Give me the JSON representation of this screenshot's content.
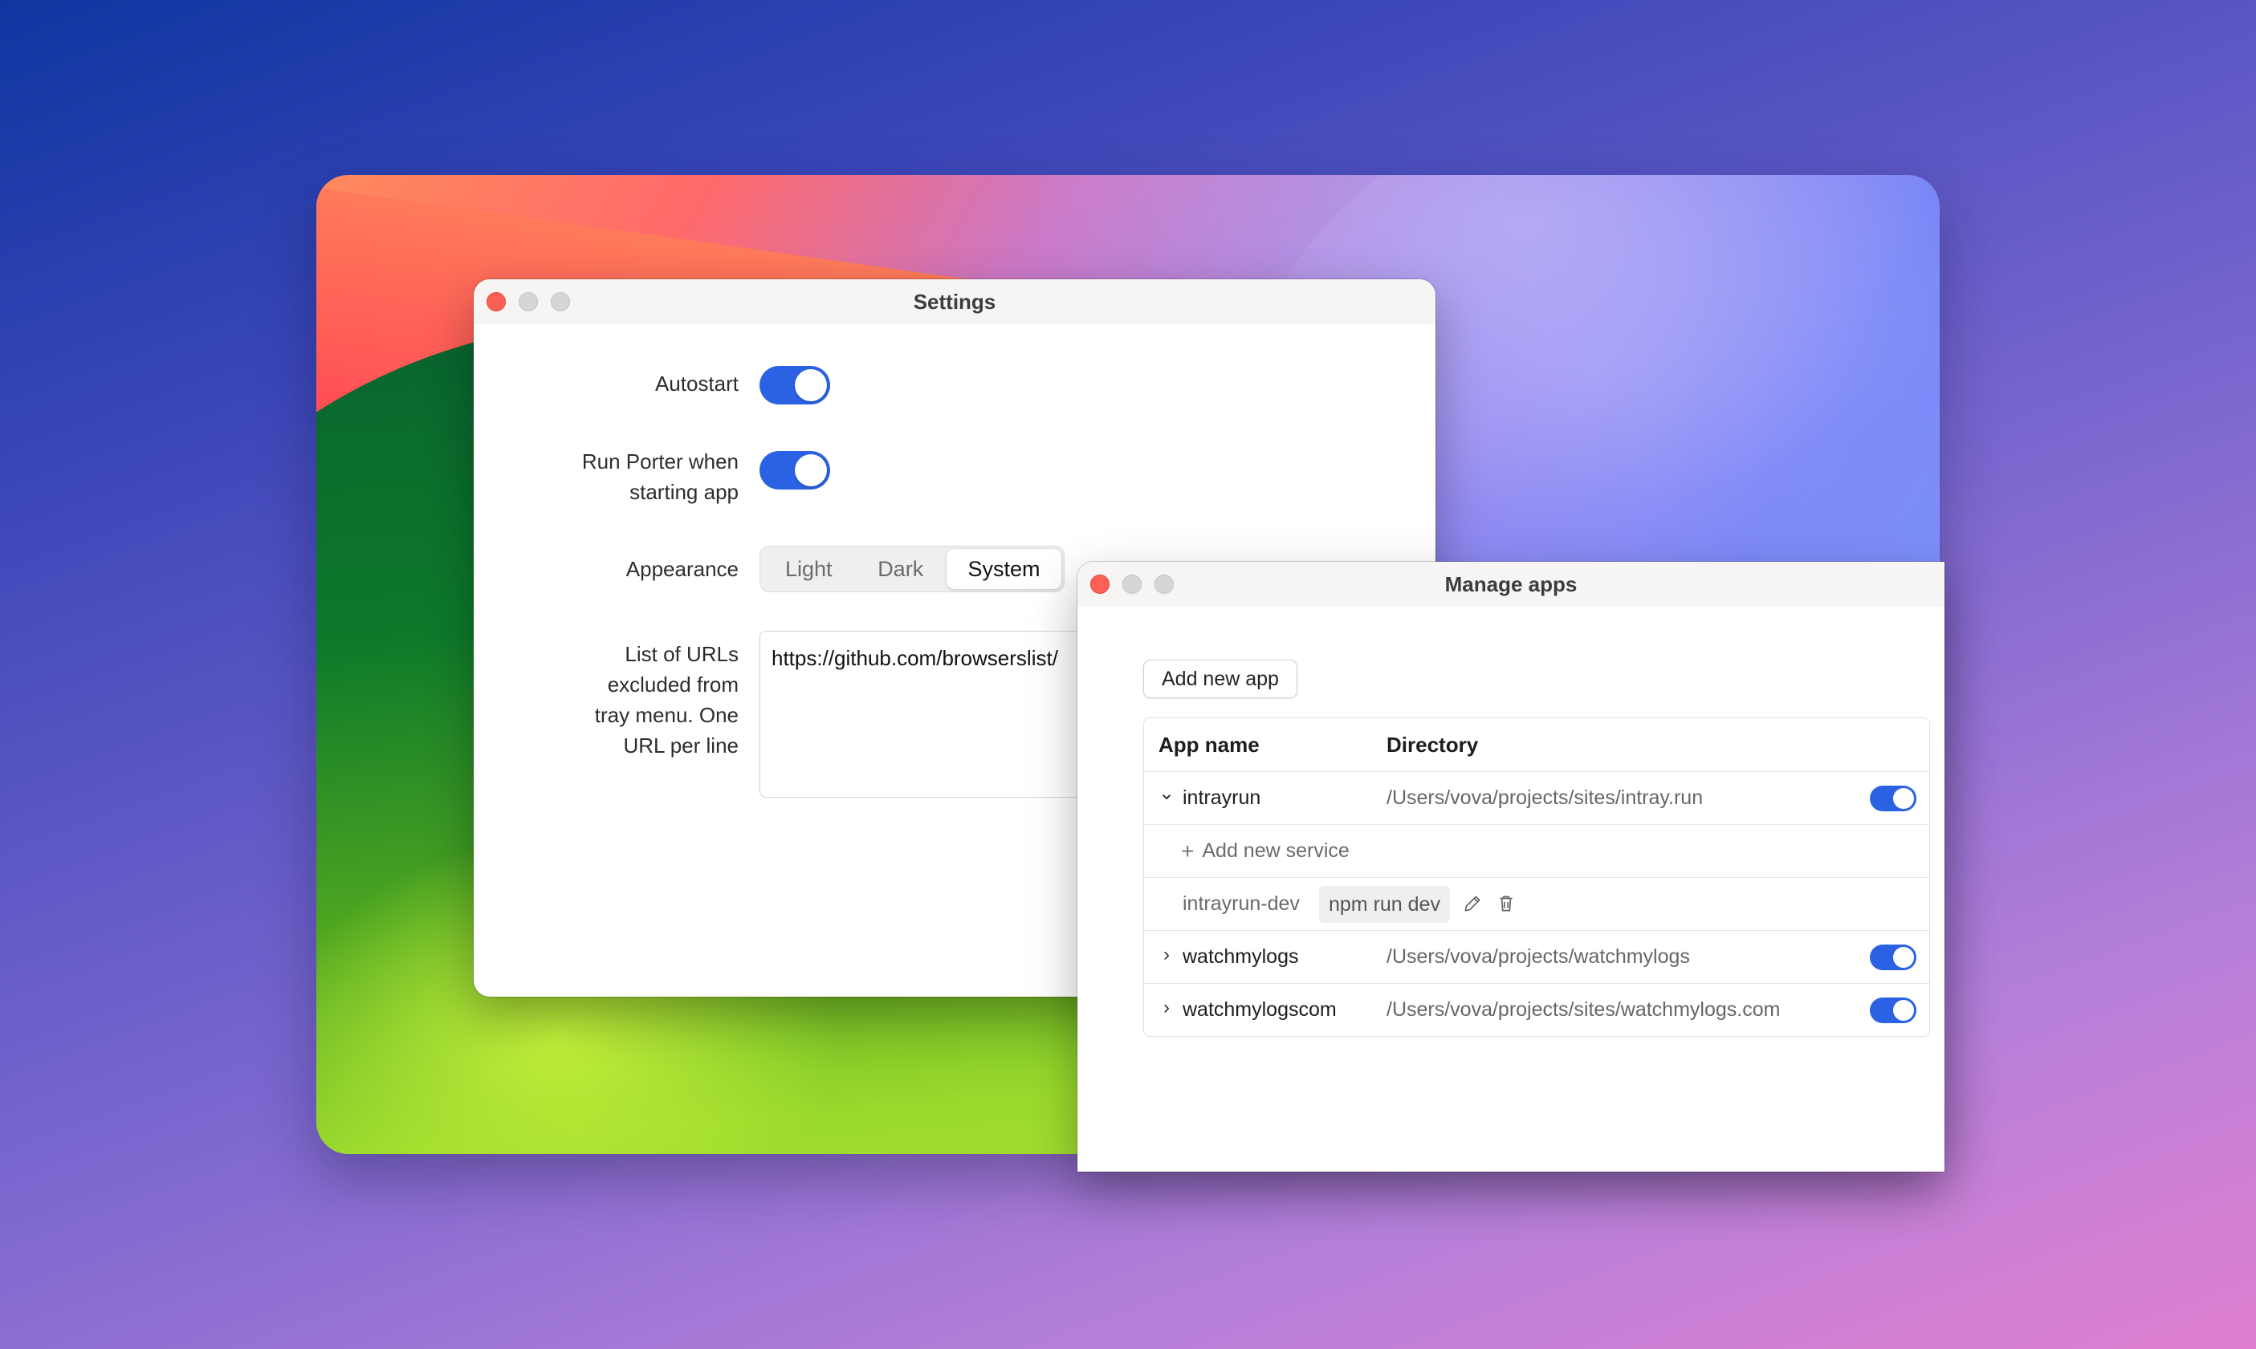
{
  "settings": {
    "title": "Settings",
    "autostart_label": "Autostart",
    "autostart_on": true,
    "run_porter_label_line1": "Run Porter when",
    "run_porter_label_line2": "starting app",
    "run_porter_on": true,
    "appearance_label": "Appearance",
    "appearance_options": [
      "Light",
      "Dark",
      "System"
    ],
    "appearance_selected": "System",
    "urls_label_lines": [
      "List of URLs",
      "excluded from",
      "tray menu. One",
      "URL per line"
    ],
    "urls_value": "https://github.com/browserslist/"
  },
  "manage": {
    "title": "Manage apps",
    "add_app_label": "Add new app",
    "columns": {
      "name": "App name",
      "directory": "Directory"
    },
    "apps": [
      {
        "name": "intrayrun",
        "directory": "/Users/vova/projects/sites/intray.run",
        "expanded": true,
        "enabled": true
      },
      {
        "name": "watchmylogs",
        "directory": "/Users/vova/projects/watchmylogs",
        "expanded": false,
        "enabled": true
      },
      {
        "name": "watchmylogscom",
        "directory": "/Users/vova/projects/sites/watchmylogs.com",
        "expanded": false,
        "enabled": true
      }
    ],
    "add_service_label": "Add new service",
    "service": {
      "name": "intrayrun-dev",
      "command": "npm run dev"
    }
  },
  "icons": {
    "chevron_expanded": "⌄",
    "chevron_collapsed": "›",
    "plus": "+"
  },
  "colors": {
    "accent": "#2b62e4",
    "close_dot": "#fe5f57"
  }
}
